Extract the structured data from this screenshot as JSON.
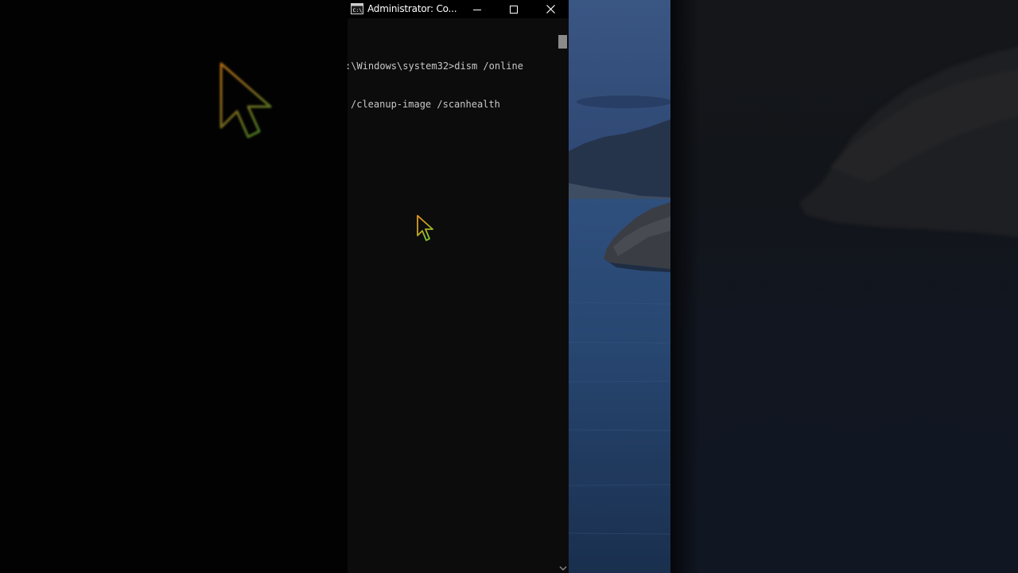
{
  "window": {
    "title": "Administrator: Co...",
    "icon": "cmd-icon",
    "controls": {
      "minimize_icon": "minimize-icon",
      "maximize_icon": "maximize-icon",
      "close_icon": "close-icon"
    }
  },
  "console": {
    "line1": ":\\Windows\\system32>dism /online",
    "line2": "/cleanup-image /scanhealth"
  },
  "colors": {
    "console_bg": "#0c0c0c",
    "console_text": "#c8c8c8",
    "titlebar_bg": "#000000",
    "wallpaper_sky": "#3a5180",
    "wallpaper_sea": "#1d3356",
    "cursor_outline_top": "#e8a020",
    "cursor_outline_bottom": "#7fc832"
  }
}
